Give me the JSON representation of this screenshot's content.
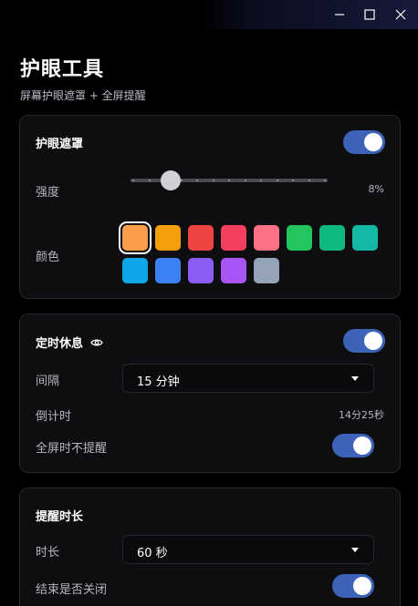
{
  "window": {
    "controls": [
      "minimize-icon",
      "maximize-icon",
      "close-icon"
    ],
    "titlebar_color": "#161a3a"
  },
  "header": {
    "title": "护眼工具",
    "subtitle": "屏幕护眼遮罩 + 全屏提醒"
  },
  "eye_mask": {
    "title": "护眼遮罩",
    "enabled": true,
    "intensity_label": "强度",
    "intensity_value": "8%",
    "intensity_fraction": 0.08,
    "color_label": "颜色",
    "selected_color_index": 0,
    "colors": [
      "#fb9d49",
      "#f59e0b",
      "#ef4444",
      "#f43f5e",
      "#fb7185",
      "#22c55e",
      "#10b981",
      "#14b8a6",
      "#0ea5e9",
      "#3b82f6",
      "#8b5cf6",
      "#a855f7",
      "#94a3b8"
    ]
  },
  "timed_break": {
    "title": "定时休息",
    "title_icon": "eye-icon",
    "enabled": true,
    "interval_label": "间隔",
    "interval_value": "15 分钟",
    "countdown_label": "倒计时",
    "countdown_value": "14分25秒",
    "no_remind_fullscreen_label": "全屏时不提醒",
    "no_remind_fullscreen_enabled": true
  },
  "reminder_duration": {
    "title": "提醒时长",
    "duration_label": "时长",
    "duration_value": "60 秒",
    "close_on_end_label": "结束是否关闭",
    "close_on_end_enabled": true
  },
  "accent_color": "#3c63b8"
}
